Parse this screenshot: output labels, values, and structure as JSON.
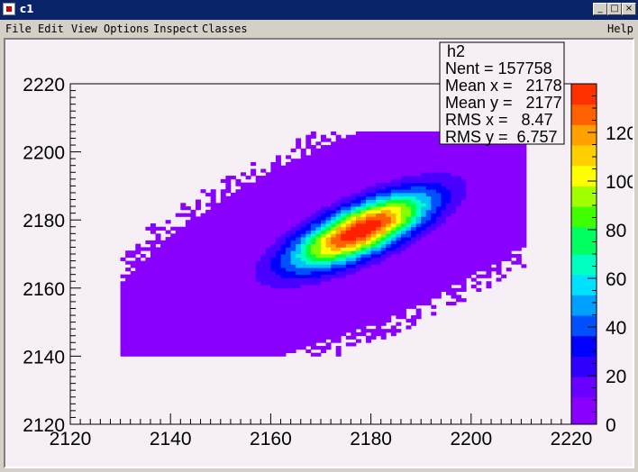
{
  "window": {
    "title": "c1"
  },
  "titlebar_buttons": {
    "minimize": "_",
    "maximize": "□",
    "close": "×"
  },
  "menu": {
    "items": [
      "File",
      "Edit",
      "View",
      "Options",
      "Inspect",
      "Classes"
    ],
    "help": "Help"
  },
  "stats": {
    "name": "h2",
    "lines": [
      "Nent = 157758",
      "Mean x =   2178",
      "Mean y =   2177",
      "RMS x =   8.47",
      "RMS y =  6.757"
    ]
  },
  "chart_data": {
    "type": "heatmap",
    "x_range": [
      2120,
      2220
    ],
    "y_range": [
      2120,
      2220
    ],
    "x_ticks": [
      "2120",
      "2140",
      "2160",
      "2180",
      "2200",
      "2220"
    ],
    "y_ticks": [
      "2120",
      "2140",
      "2160",
      "2180",
      "2200",
      "2220"
    ],
    "z_range": [
      0,
      140
    ],
    "z_ticks": [
      "0",
      "20",
      "40",
      "60",
      "80",
      "100",
      "120"
    ],
    "palette": [
      "#8a00ff",
      "#4a00ff",
      "#0000ff",
      "#0050ff",
      "#00c0ff",
      "#00ffc0",
      "#00ff40",
      "#80ff00",
      "#ffff00",
      "#ffb000",
      "#ff6000",
      "#ff2000"
    ],
    "peak": {
      "x": 2178,
      "y": 2177,
      "value": 140
    },
    "rms": {
      "x": 8.47,
      "y": 6.757
    },
    "entries": 157758
  }
}
